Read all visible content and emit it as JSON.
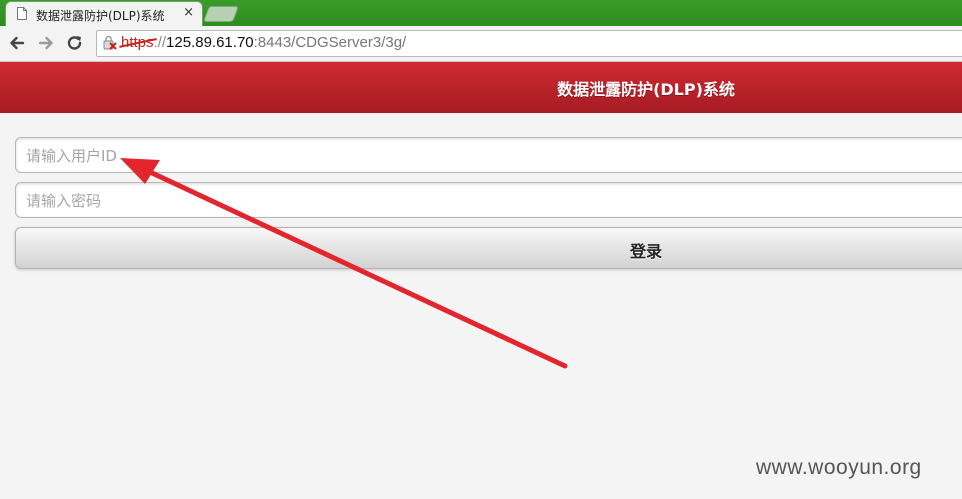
{
  "browser": {
    "tab_title": "数据泄露防护(DLP)系统",
    "tab_close": "×",
    "url_scheme": "https",
    "url_sep": "://",
    "url_host": "125.89.61.70",
    "url_rest": ":8443/CDGServer3/3g/"
  },
  "header": {
    "title": "数据泄露防护(DLP)系统"
  },
  "form": {
    "user_placeholder": "请输入用户ID",
    "password_placeholder": "请输入密码",
    "login_label": "登录"
  },
  "overlay": {
    "arrow_color": "#e3262d"
  },
  "watermark": "www.wooyun.org",
  "colors": {
    "header_red": "#b72128",
    "tabstrip_green": "#2c8d1f"
  }
}
